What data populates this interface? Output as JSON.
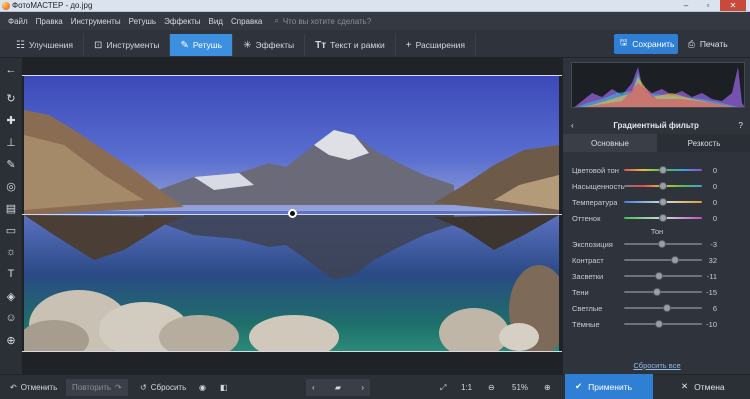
{
  "window": {
    "title": "ФотоМАСТЕР - до.jpg"
  },
  "menu": {
    "items": [
      "Файл",
      "Правка",
      "Инструменты",
      "Ретушь",
      "Эффекты",
      "Вид",
      "Справка"
    ],
    "search_placeholder": "Что вы хотите сделать?"
  },
  "toolbar": {
    "tabs": [
      {
        "label": "Улучшения",
        "icon": "sliders-icon"
      },
      {
        "label": "Инструменты",
        "icon": "crop-icon"
      },
      {
        "label": "Ретушь",
        "icon": "brush-icon",
        "active": true
      },
      {
        "label": "Эффекты",
        "icon": "magic-wand-icon"
      },
      {
        "label": "Текст и рамки",
        "icon": "text-icon"
      },
      {
        "label": "Расширения",
        "icon": "plus-icon"
      }
    ],
    "save_label": "Сохранить",
    "print_label": "Печать"
  },
  "panel": {
    "title": "Градиентный фильтр",
    "tabs": [
      "Основные",
      "Резкость"
    ],
    "color_sliders": [
      {
        "label": "Цветовой тон",
        "value": "0"
      },
      {
        "label": "Насыщенность",
        "value": "0"
      },
      {
        "label": "Температура",
        "value": "0"
      },
      {
        "label": "Оттенок",
        "value": "0"
      }
    ],
    "tone_section": "Тон",
    "tone_sliders": [
      {
        "label": "Экспозиция",
        "value": "-3"
      },
      {
        "label": "Контраст",
        "value": "32"
      },
      {
        "label": "Засветки",
        "value": "-11"
      },
      {
        "label": "Тени",
        "value": "-15"
      },
      {
        "label": "Светлые",
        "value": "6"
      },
      {
        "label": "Тёмные",
        "value": "-10"
      }
    ],
    "reset_all": "Сбросить все"
  },
  "bottom": {
    "undo_label": "Отменить",
    "redo_label": "Повторить",
    "reset_label": "Сбросить",
    "zoom_1to1": "1:1",
    "zoom_value": "51%",
    "apply_label": "Применить",
    "cancel_label": "Отмена"
  },
  "colors": {
    "accent": "#2f7fd4",
    "active_tab": "#3d8fe0"
  }
}
